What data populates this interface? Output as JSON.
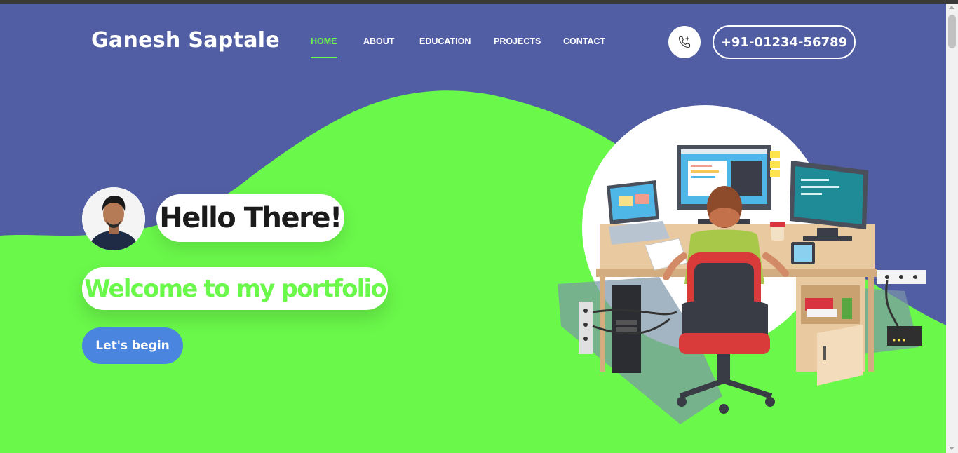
{
  "brand": {
    "name": "Ganesh Saptale"
  },
  "nav": {
    "items": [
      {
        "label": "HOME",
        "active": true
      },
      {
        "label": "ABOUT",
        "active": false
      },
      {
        "label": "EDUCATION",
        "active": false
      },
      {
        "label": "PROJECTS",
        "active": false
      },
      {
        "label": "CONTACT",
        "active": false
      }
    ]
  },
  "contact": {
    "phone_icon": "phone-plus-icon",
    "phone": "+91-01234-56789"
  },
  "hero": {
    "greeting": "Hello There!",
    "subtitle": "Welcome to my portfolio",
    "cta": "Let's begin"
  },
  "colors": {
    "header_bg": "#525ea3",
    "accent": "#6af84a",
    "button": "#4a85e0"
  }
}
